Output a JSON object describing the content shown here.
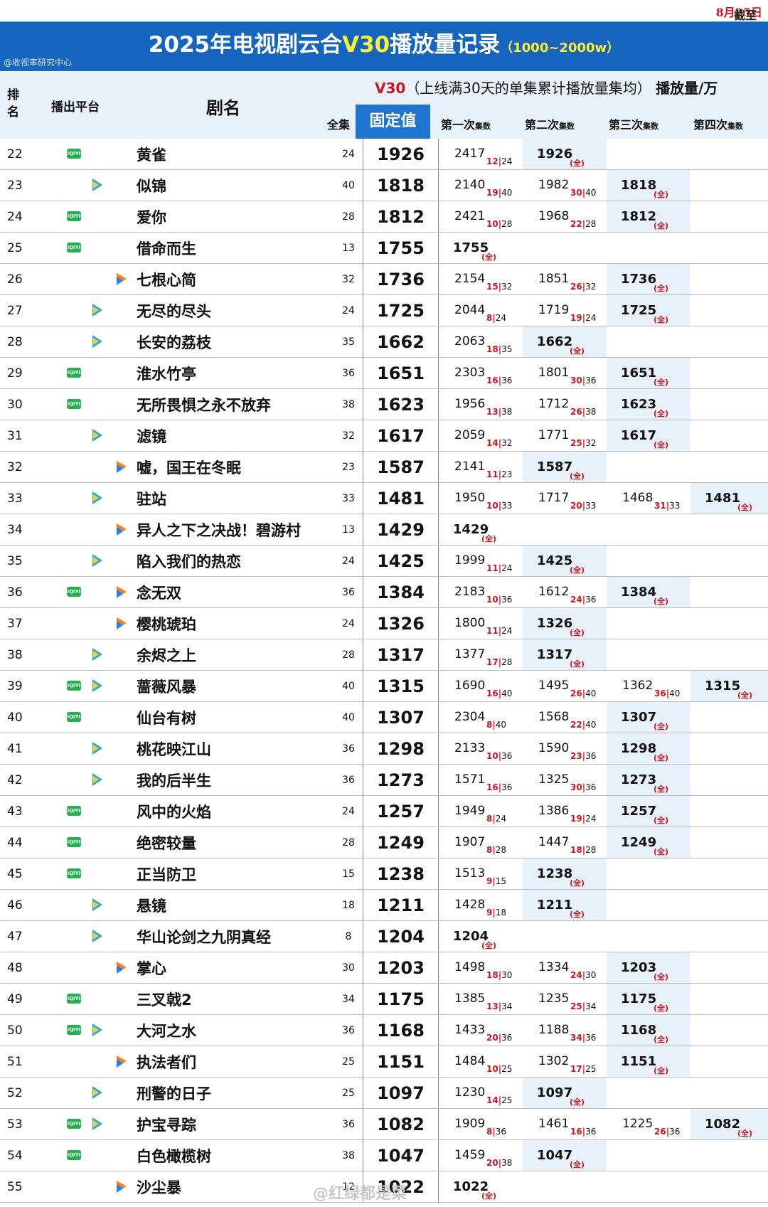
{
  "date_prefix": "截至",
  "date_value": "8月25日",
  "title": {
    "part1": "2025年电视剧云合",
    "v30": "V30",
    "part2": "播放量记录",
    "range": "（1000~2000w）"
  },
  "source": "@收视率研究中心",
  "desc": {
    "v30": "V30",
    "text": "（上线满30天的单集累计播放量集均）",
    "unit": "播放量/万"
  },
  "headers": {
    "rank": "排名",
    "platform": "播出平台",
    "title": "剧名",
    "episodes": "全集",
    "fixed": "固定值",
    "attempts": [
      "第一次",
      "第二次",
      "第三次",
      "第四次"
    ],
    "ep_suffix": "集数",
    "full_mark": "(全)"
  },
  "watermark": "@红绿都是菜",
  "rows": [
    {
      "rank": "22",
      "platforms": [
        "iqiyi"
      ],
      "title": "黄雀",
      "eps": "24",
      "fixed": "1926",
      "attempts": [
        {
          "v": "2417",
          "n": "12",
          "t": "24"
        },
        {
          "v": "1926"
        }
      ]
    },
    {
      "rank": "23",
      "platforms": [
        "tencent"
      ],
      "title": "似锦",
      "eps": "40",
      "fixed": "1818",
      "attempts": [
        {
          "v": "2140",
          "n": "19",
          "t": "40"
        },
        {
          "v": "1982",
          "n": "30",
          "t": "40"
        },
        {
          "v": "1818"
        }
      ]
    },
    {
      "rank": "24",
      "platforms": [
        "iqiyi"
      ],
      "title": "爱你",
      "eps": "28",
      "fixed": "1812",
      "attempts": [
        {
          "v": "2421",
          "n": "10",
          "t": "28"
        },
        {
          "v": "1968",
          "n": "22",
          "t": "28"
        },
        {
          "v": "1812"
        }
      ]
    },
    {
      "rank": "25",
      "platforms": [
        "iqiyi"
      ],
      "title": "借命而生",
      "eps": "13",
      "fixed": "1755",
      "attempts": [
        {
          "v": "1755"
        }
      ]
    },
    {
      "rank": "26",
      "platforms": [
        "youku"
      ],
      "title": "七根心简",
      "eps": "32",
      "fixed": "1736",
      "attempts": [
        {
          "v": "2154",
          "n": "15",
          "t": "32"
        },
        {
          "v": "1851",
          "n": "26",
          "t": "32"
        },
        {
          "v": "1736"
        }
      ]
    },
    {
      "rank": "27",
      "platforms": [
        "tencent"
      ],
      "title": "无尽的尽头",
      "eps": "24",
      "fixed": "1725",
      "attempts": [
        {
          "v": "2044",
          "n": "8",
          "t": "24"
        },
        {
          "v": "1719",
          "n": "19",
          "t": "24"
        },
        {
          "v": "1725"
        }
      ]
    },
    {
      "rank": "28",
      "platforms": [
        "tencent"
      ],
      "title": "长安的荔枝",
      "eps": "35",
      "fixed": "1662",
      "attempts": [
        {
          "v": "2063",
          "n": "18",
          "t": "35"
        },
        {
          "v": "1662"
        }
      ]
    },
    {
      "rank": "29",
      "platforms": [
        "iqiyi"
      ],
      "title": "淮水竹亭",
      "eps": "36",
      "fixed": "1651",
      "attempts": [
        {
          "v": "2303",
          "n": "16",
          "t": "36"
        },
        {
          "v": "1801",
          "n": "30",
          "t": "36"
        },
        {
          "v": "1651"
        }
      ]
    },
    {
      "rank": "30",
      "platforms": [
        "iqiyi"
      ],
      "title": "无所畏惧之永不放弃",
      "eps": "38",
      "fixed": "1623",
      "attempts": [
        {
          "v": "1956",
          "n": "13",
          "t": "38"
        },
        {
          "v": "1712",
          "n": "26",
          "t": "38"
        },
        {
          "v": "1623"
        }
      ]
    },
    {
      "rank": "31",
      "platforms": [
        "tencent"
      ],
      "title": "滤镜",
      "eps": "32",
      "fixed": "1617",
      "attempts": [
        {
          "v": "2059",
          "n": "14",
          "t": "32"
        },
        {
          "v": "1771",
          "n": "25",
          "t": "32"
        },
        {
          "v": "1617"
        }
      ]
    },
    {
      "rank": "32",
      "platforms": [
        "youku"
      ],
      "title": "嘘，国王在冬眠",
      "eps": "23",
      "fixed": "1587",
      "attempts": [
        {
          "v": "2141",
          "n": "11",
          "t": "23"
        },
        {
          "v": "1587"
        }
      ]
    },
    {
      "rank": "33",
      "platforms": [
        "tencent"
      ],
      "title": "驻站",
      "eps": "33",
      "fixed": "1481",
      "attempts": [
        {
          "v": "1950",
          "n": "10",
          "t": "33"
        },
        {
          "v": "1717",
          "n": "20",
          "t": "33"
        },
        {
          "v": "1468",
          "n": "31",
          "t": "33"
        },
        {
          "v": "1481"
        }
      ]
    },
    {
      "rank": "34",
      "platforms": [
        "youku"
      ],
      "title": "异人之下之决战！碧游村",
      "eps": "13",
      "fixed": "1429",
      "attempts": [
        {
          "v": "1429"
        }
      ]
    },
    {
      "rank": "35",
      "platforms": [
        "tencent"
      ],
      "title": "陷入我们的热恋",
      "eps": "24",
      "fixed": "1425",
      "attempts": [
        {
          "v": "1999",
          "n": "11",
          "t": "24"
        },
        {
          "v": "1425"
        }
      ]
    },
    {
      "rank": "36",
      "platforms": [
        "iqiyi",
        "youku"
      ],
      "title": "念无双",
      "eps": "36",
      "fixed": "1384",
      "attempts": [
        {
          "v": "2183",
          "n": "10",
          "t": "36"
        },
        {
          "v": "1612",
          "n": "24",
          "t": "36"
        },
        {
          "v": "1384"
        }
      ]
    },
    {
      "rank": "37",
      "platforms": [
        "youku"
      ],
      "title": "樱桃琥珀",
      "eps": "24",
      "fixed": "1326",
      "attempts": [
        {
          "v": "1800",
          "n": "11",
          "t": "24"
        },
        {
          "v": "1326"
        }
      ]
    },
    {
      "rank": "38",
      "platforms": [
        "tencent"
      ],
      "title": "余烬之上",
      "eps": "28",
      "fixed": "1317",
      "attempts": [
        {
          "v": "1377",
          "n": "17",
          "t": "28"
        },
        {
          "v": "1317"
        }
      ]
    },
    {
      "rank": "39",
      "platforms": [
        "iqiyi",
        "tencent"
      ],
      "title": "蔷薇风暴",
      "eps": "40",
      "fixed": "1315",
      "attempts": [
        {
          "v": "1690",
          "n": "16",
          "t": "40"
        },
        {
          "v": "1495",
          "n": "26",
          "t": "40"
        },
        {
          "v": "1362",
          "n": "36",
          "t": "40"
        },
        {
          "v": "1315"
        }
      ]
    },
    {
      "rank": "40",
      "platforms": [
        "iqiyi"
      ],
      "title": "仙台有树",
      "eps": "40",
      "fixed": "1307",
      "attempts": [
        {
          "v": "2304",
          "n": "8",
          "t": "40"
        },
        {
          "v": "1568",
          "n": "22",
          "t": "40"
        },
        {
          "v": "1307"
        }
      ]
    },
    {
      "rank": "41",
      "platforms": [
        "tencent"
      ],
      "title": "桃花映江山",
      "eps": "36",
      "fixed": "1298",
      "attempts": [
        {
          "v": "2133",
          "n": "10",
          "t": "36"
        },
        {
          "v": "1590",
          "n": "23",
          "t": "36"
        },
        {
          "v": "1298"
        }
      ]
    },
    {
      "rank": "42",
      "platforms": [
        "tencent"
      ],
      "title": "我的后半生",
      "eps": "36",
      "fixed": "1273",
      "attempts": [
        {
          "v": "1571",
          "n": "16",
          "t": "36"
        },
        {
          "v": "1325",
          "n": "30",
          "t": "36"
        },
        {
          "v": "1273"
        }
      ]
    },
    {
      "rank": "43",
      "platforms": [
        "iqiyi"
      ],
      "title": "风中的火焰",
      "eps": "24",
      "fixed": "1257",
      "attempts": [
        {
          "v": "1949",
          "n": "8",
          "t": "24"
        },
        {
          "v": "1386",
          "n": "19",
          "t": "24"
        },
        {
          "v": "1257"
        }
      ]
    },
    {
      "rank": "44",
      "platforms": [
        "iqiyi"
      ],
      "title": "绝密较量",
      "eps": "28",
      "fixed": "1249",
      "attempts": [
        {
          "v": "1907",
          "n": "8",
          "t": "28"
        },
        {
          "v": "1447",
          "n": "18",
          "t": "28"
        },
        {
          "v": "1249"
        }
      ]
    },
    {
      "rank": "45",
      "platforms": [
        "iqiyi"
      ],
      "title": "正当防卫",
      "eps": "15",
      "fixed": "1238",
      "attempts": [
        {
          "v": "1513",
          "n": "9",
          "t": "15"
        },
        {
          "v": "1238"
        }
      ]
    },
    {
      "rank": "46",
      "platforms": [
        "tencent"
      ],
      "title": "悬镜",
      "eps": "18",
      "fixed": "1211",
      "attempts": [
        {
          "v": "1428",
          "n": "9",
          "t": "18"
        },
        {
          "v": "1211"
        }
      ]
    },
    {
      "rank": "47",
      "platforms": [
        "tencent"
      ],
      "title": "华山论剑之九阴真经",
      "eps": "8",
      "fixed": "1204",
      "attempts": [
        {
          "v": "1204"
        }
      ]
    },
    {
      "rank": "48",
      "platforms": [
        "youku"
      ],
      "title": "掌心",
      "eps": "30",
      "fixed": "1203",
      "attempts": [
        {
          "v": "1498",
          "n": "18",
          "t": "30"
        },
        {
          "v": "1334",
          "n": "24",
          "t": "30"
        },
        {
          "v": "1203"
        }
      ]
    },
    {
      "rank": "49",
      "platforms": [
        "iqiyi"
      ],
      "title": "三叉戟2",
      "eps": "34",
      "fixed": "1175",
      "attempts": [
        {
          "v": "1385",
          "n": "13",
          "t": "34"
        },
        {
          "v": "1235",
          "n": "25",
          "t": "34"
        },
        {
          "v": "1175"
        }
      ]
    },
    {
      "rank": "50",
      "platforms": [
        "iqiyi",
        "tencent"
      ],
      "title": "大河之水",
      "eps": "36",
      "fixed": "1168",
      "attempts": [
        {
          "v": "1433",
          "n": "20",
          "t": "36"
        },
        {
          "v": "1188",
          "n": "34",
          "t": "36"
        },
        {
          "v": "1168"
        }
      ]
    },
    {
      "rank": "51",
      "platforms": [
        "youku"
      ],
      "title": "执法者们",
      "eps": "25",
      "fixed": "1151",
      "attempts": [
        {
          "v": "1484",
          "n": "10",
          "t": "25"
        },
        {
          "v": "1302",
          "n": "17",
          "t": "25"
        },
        {
          "v": "1151"
        }
      ]
    },
    {
      "rank": "52",
      "platforms": [
        "tencent"
      ],
      "title": "刑警的日子",
      "eps": "25",
      "fixed": "1097",
      "attempts": [
        {
          "v": "1230",
          "n": "14",
          "t": "25"
        },
        {
          "v": "1097"
        }
      ]
    },
    {
      "rank": "53",
      "platforms": [
        "iqiyi",
        "tencent"
      ],
      "title": "护宝寻踪",
      "eps": "36",
      "fixed": "1082",
      "attempts": [
        {
          "v": "1909",
          "n": "8",
          "t": "36"
        },
        {
          "v": "1461",
          "n": "16",
          "t": "36"
        },
        {
          "v": "1225",
          "n": "26",
          "t": "36"
        },
        {
          "v": "1082"
        }
      ]
    },
    {
      "rank": "54",
      "platforms": [
        "iqiyi"
      ],
      "title": "白色橄榄树",
      "eps": "38",
      "fixed": "1047",
      "attempts": [
        {
          "v": "1459",
          "n": "20",
          "t": "38"
        },
        {
          "v": "1047"
        }
      ]
    },
    {
      "rank": "55",
      "platforms": [
        "youku"
      ],
      "title": "沙尘暴",
      "eps": "12",
      "fixed": "1022",
      "attempts": [
        {
          "v": "1022"
        }
      ]
    }
  ]
}
